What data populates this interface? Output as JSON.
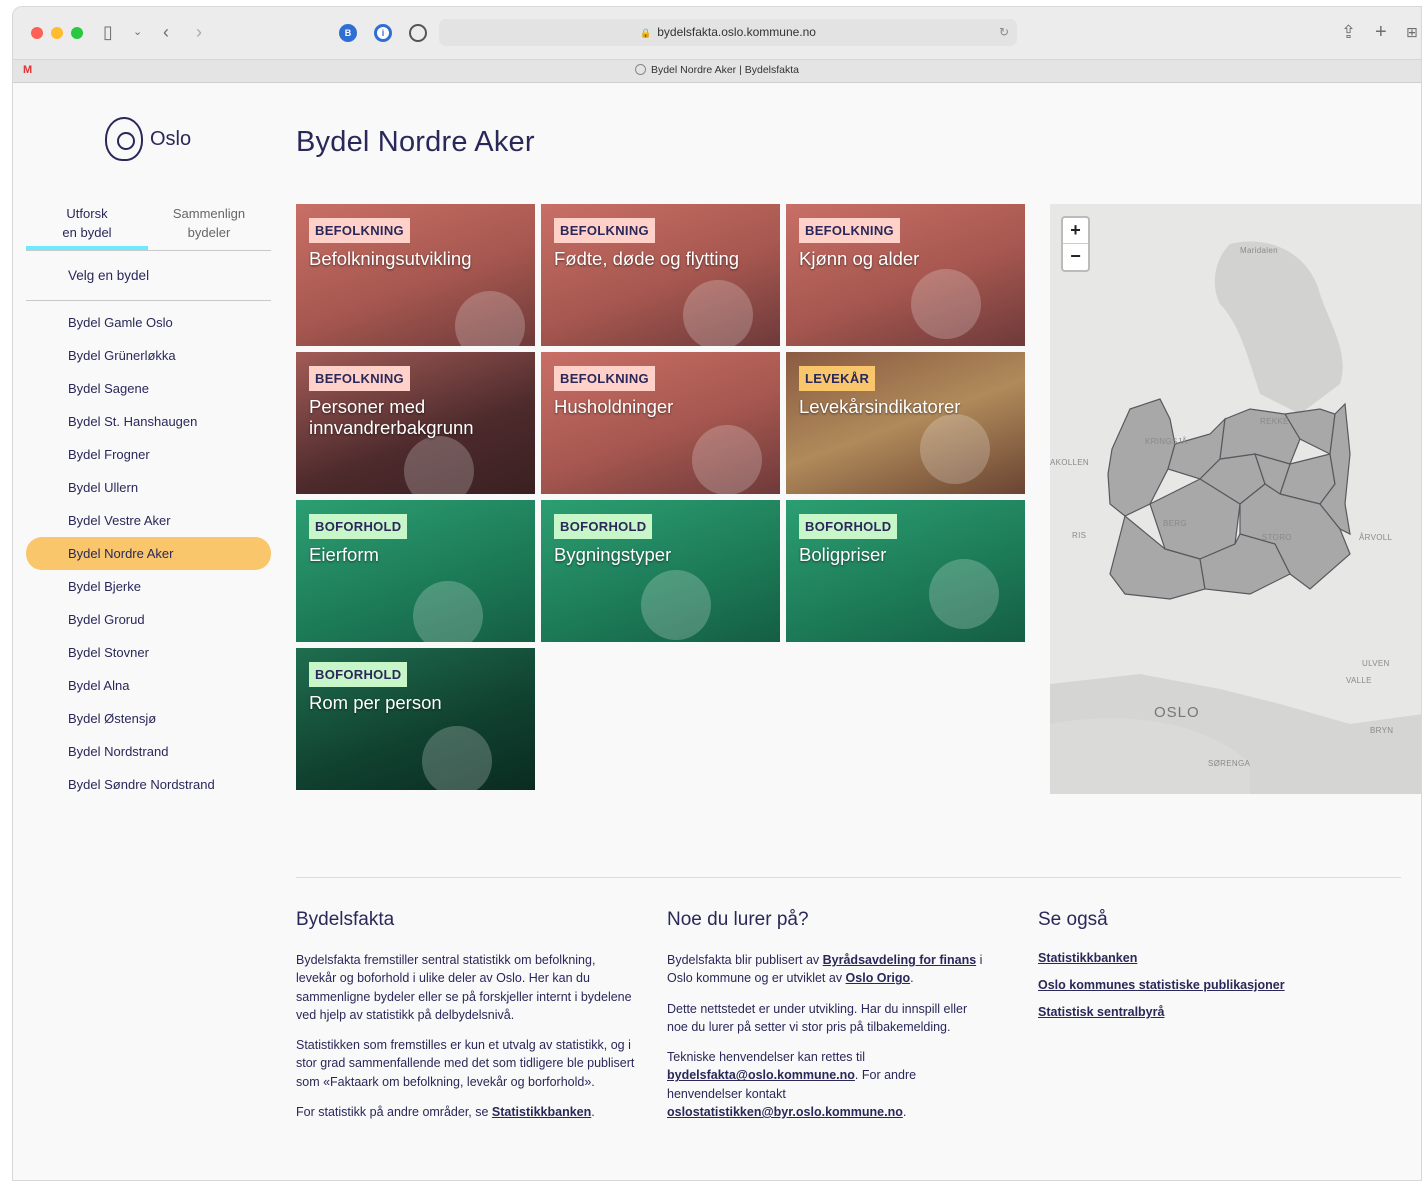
{
  "browser": {
    "url": "bydelsfakta.oslo.kommune.no",
    "tab_title": "Bydel Nordre Aker | Bydelsfakta"
  },
  "logo_text": "Oslo",
  "sidebar": {
    "tabs": [
      {
        "label": "Utforsk\nen bydel",
        "active": true
      },
      {
        "label": "Sammenlign\nbydeler",
        "active": false
      }
    ],
    "pick_label": "Velg en bydel",
    "districts": [
      "Bydel Gamle Oslo",
      "Bydel Grünerløkka",
      "Bydel Sagene",
      "Bydel St. Hanshaugen",
      "Bydel Frogner",
      "Bydel Ullern",
      "Bydel Vestre Aker",
      "Bydel Nordre Aker",
      "Bydel Bjerke",
      "Bydel Grorud",
      "Bydel Stovner",
      "Bydel Alna",
      "Bydel Østensjø",
      "Bydel Nordstrand",
      "Bydel Søndre Nordstrand"
    ],
    "selected": "Bydel Nordre Aker"
  },
  "main": {
    "title": "Bydel Nordre Aker",
    "tiles": [
      {
        "badge": "BEFOLKNING",
        "title": "Befolkningsutvikling"
      },
      {
        "badge": "BEFOLKNING",
        "title": "Fødte, døde og flytting"
      },
      {
        "badge": "BEFOLKNING",
        "title": "Kjønn og alder"
      },
      {
        "badge": "BEFOLKNING",
        "title": "Personer med innvandrerbakgrunn"
      },
      {
        "badge": "BEFOLKNING",
        "title": "Husholdninger"
      },
      {
        "badge": "LEVEKÅR",
        "title": "Levekårsindikatorer"
      },
      {
        "badge": "BOFORHOLD",
        "title": "Eierform"
      },
      {
        "badge": "BOFORHOLD",
        "title": "Bygningstyper"
      },
      {
        "badge": "BOFORHOLD",
        "title": "Boligpriser"
      },
      {
        "badge": "BOFORHOLD",
        "title": "Rom per person"
      }
    ]
  },
  "map": {
    "zoom_in": "+",
    "zoom_out": "−",
    "labels": [
      "Maridalen",
      "KRINGSJÅ",
      "AKOLLEN",
      "RIS",
      "BERG",
      "STORO",
      "ÅRVOLL",
      "REKKE",
      "ULVEN",
      "VALLE",
      "BRYN",
      "SØRENGA"
    ],
    "city": "OSLO"
  },
  "footer": {
    "col1": {
      "heading": "Bydelsfakta",
      "p1": "Bydelsfakta fremstiller sentral statistikk om befolkning, levekår og boforhold i ulike deler av Oslo. Her kan du sammenligne bydeler eller se på forskjeller internt i bydelene ved hjelp av statistikk på delbydelsnivå.",
      "p2": "Statistikken som fremstilles er kun et utvalg av statistikk, og i stor grad sammenfallende med det som tidligere ble publisert som «Faktaark om befolkning, levekår og borforhold».",
      "p3_text": "For statistikk på andre områder, se ",
      "p3_link": "Statistikkbanken",
      "p3_end": "."
    },
    "col2": {
      "heading": "Noe du lurer på?",
      "p1_a": "Bydelsfakta blir publisert av ",
      "p1_link1": "Byrådsavdeling for finans",
      "p1_b": " i Oslo kommune og er utviklet av ",
      "p1_link2": "Oslo Origo",
      "p1_c": ".",
      "p2": "Dette nettstedet er under utvikling. Har du innspill eller noe du lurer på setter vi stor pris på tilbakemelding.",
      "p3_a": "Tekniske henvendelser kan rettes til ",
      "p3_link1": "bydelsfakta@oslo.kommune.no",
      "p3_b": ". For andre henvendelser kontakt ",
      "p3_link2": "oslostatistikken@byr.oslo.kommune.no",
      "p3_c": "."
    },
    "col3": {
      "heading": "Se også",
      "links": [
        "Statistikkbanken",
        "Oslo kommunes statistiske publikasjoner",
        "Statistisk sentralbyrå"
      ]
    }
  }
}
